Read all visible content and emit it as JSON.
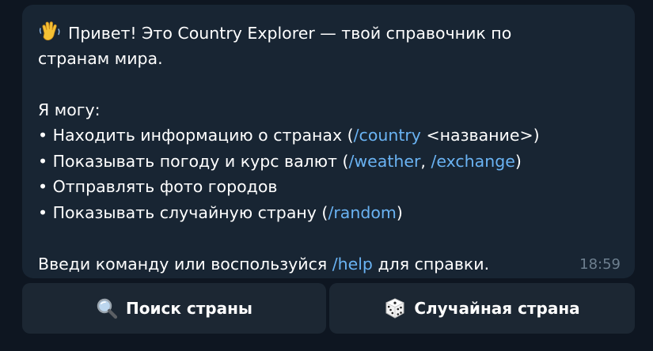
{
  "message": {
    "greeting_emoji": "waving-hand-icon",
    "lines": [
      [
        "Привет! Это Country Explorer — твой справочник по"
      ],
      [
        "странам мира."
      ],
      [
        "Я могу:"
      ],
      [
        "• Находить информацию о странах (",
        "/country",
        " <название>)"
      ],
      [
        "• Показывать погоду и курс валют (",
        "/weather",
        ", ",
        "/exchange",
        ")"
      ],
      [
        "• Отправлять фото городов"
      ],
      [
        "• Показывать случайную страну (",
        "/random",
        ")"
      ],
      [
        "Введи команду или воспользуйся ",
        "/help",
        " для справки."
      ]
    ],
    "time": "18:59"
  },
  "keyboard": {
    "search_label": "Поиск страны",
    "search_icon": "magnifier-icon",
    "random_label": "Случайная страна",
    "random_icon": "dice-icon"
  },
  "colors": {
    "background": "#0e1621",
    "bubble": "#182533",
    "link": "#6ab3f3",
    "button": "#1c2733",
    "timestamp": "#6d7f8f"
  }
}
